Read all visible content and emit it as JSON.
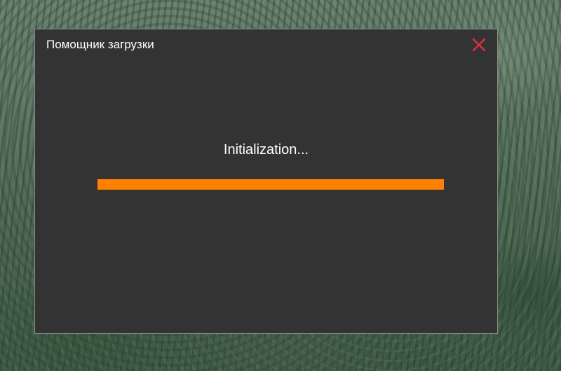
{
  "window": {
    "title": "Помощник загрузки",
    "close_icon": "close-icon",
    "close_color": "#e0303c"
  },
  "status": {
    "text": "Initialization..."
  },
  "progress": {
    "fraction": 1.0,
    "color": "#ff8000"
  },
  "colors": {
    "dialog_bg": "#333333"
  }
}
